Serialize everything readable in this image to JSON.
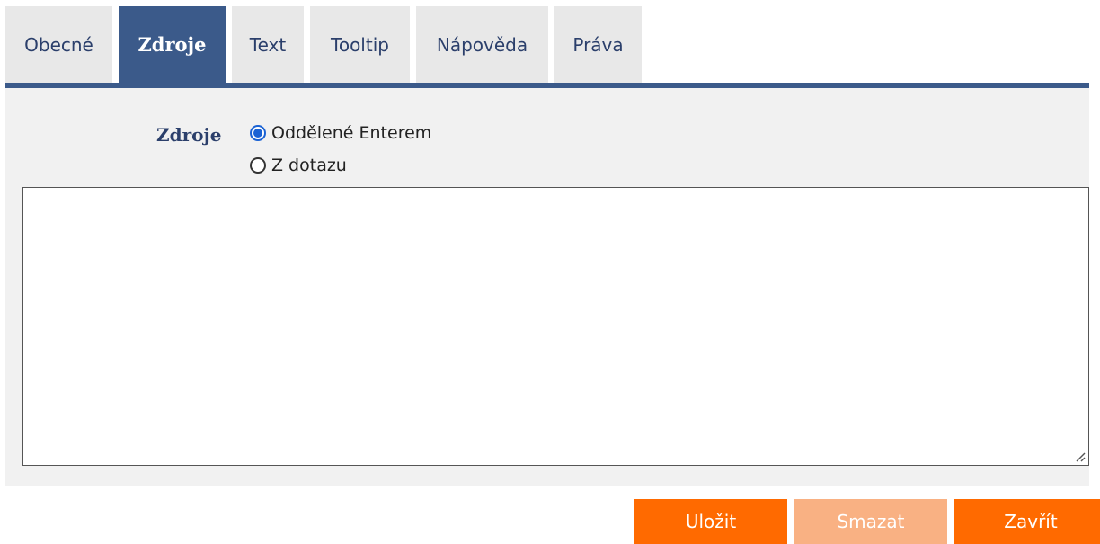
{
  "tabs": [
    {
      "label": "Obecné",
      "active": false
    },
    {
      "label": "Zdroje",
      "active": true
    },
    {
      "label": "Text",
      "active": false
    },
    {
      "label": "Tooltip",
      "active": false
    },
    {
      "label": "Nápověda",
      "active": false
    },
    {
      "label": "Práva",
      "active": false
    }
  ],
  "form": {
    "sources_label": "Zdroje",
    "options": [
      {
        "label": "Oddělené Enterem",
        "checked": true
      },
      {
        "label": "Z dotazu",
        "checked": false
      }
    ],
    "textarea_value": ""
  },
  "buttons": {
    "save": "Uložit",
    "delete": "Smazat",
    "close": "Zavřít"
  },
  "colors": {
    "accent": "#3b5a8a",
    "button": "#ff6a00",
    "button_disabled": "#f9b183",
    "radio": "#1a62d4"
  }
}
